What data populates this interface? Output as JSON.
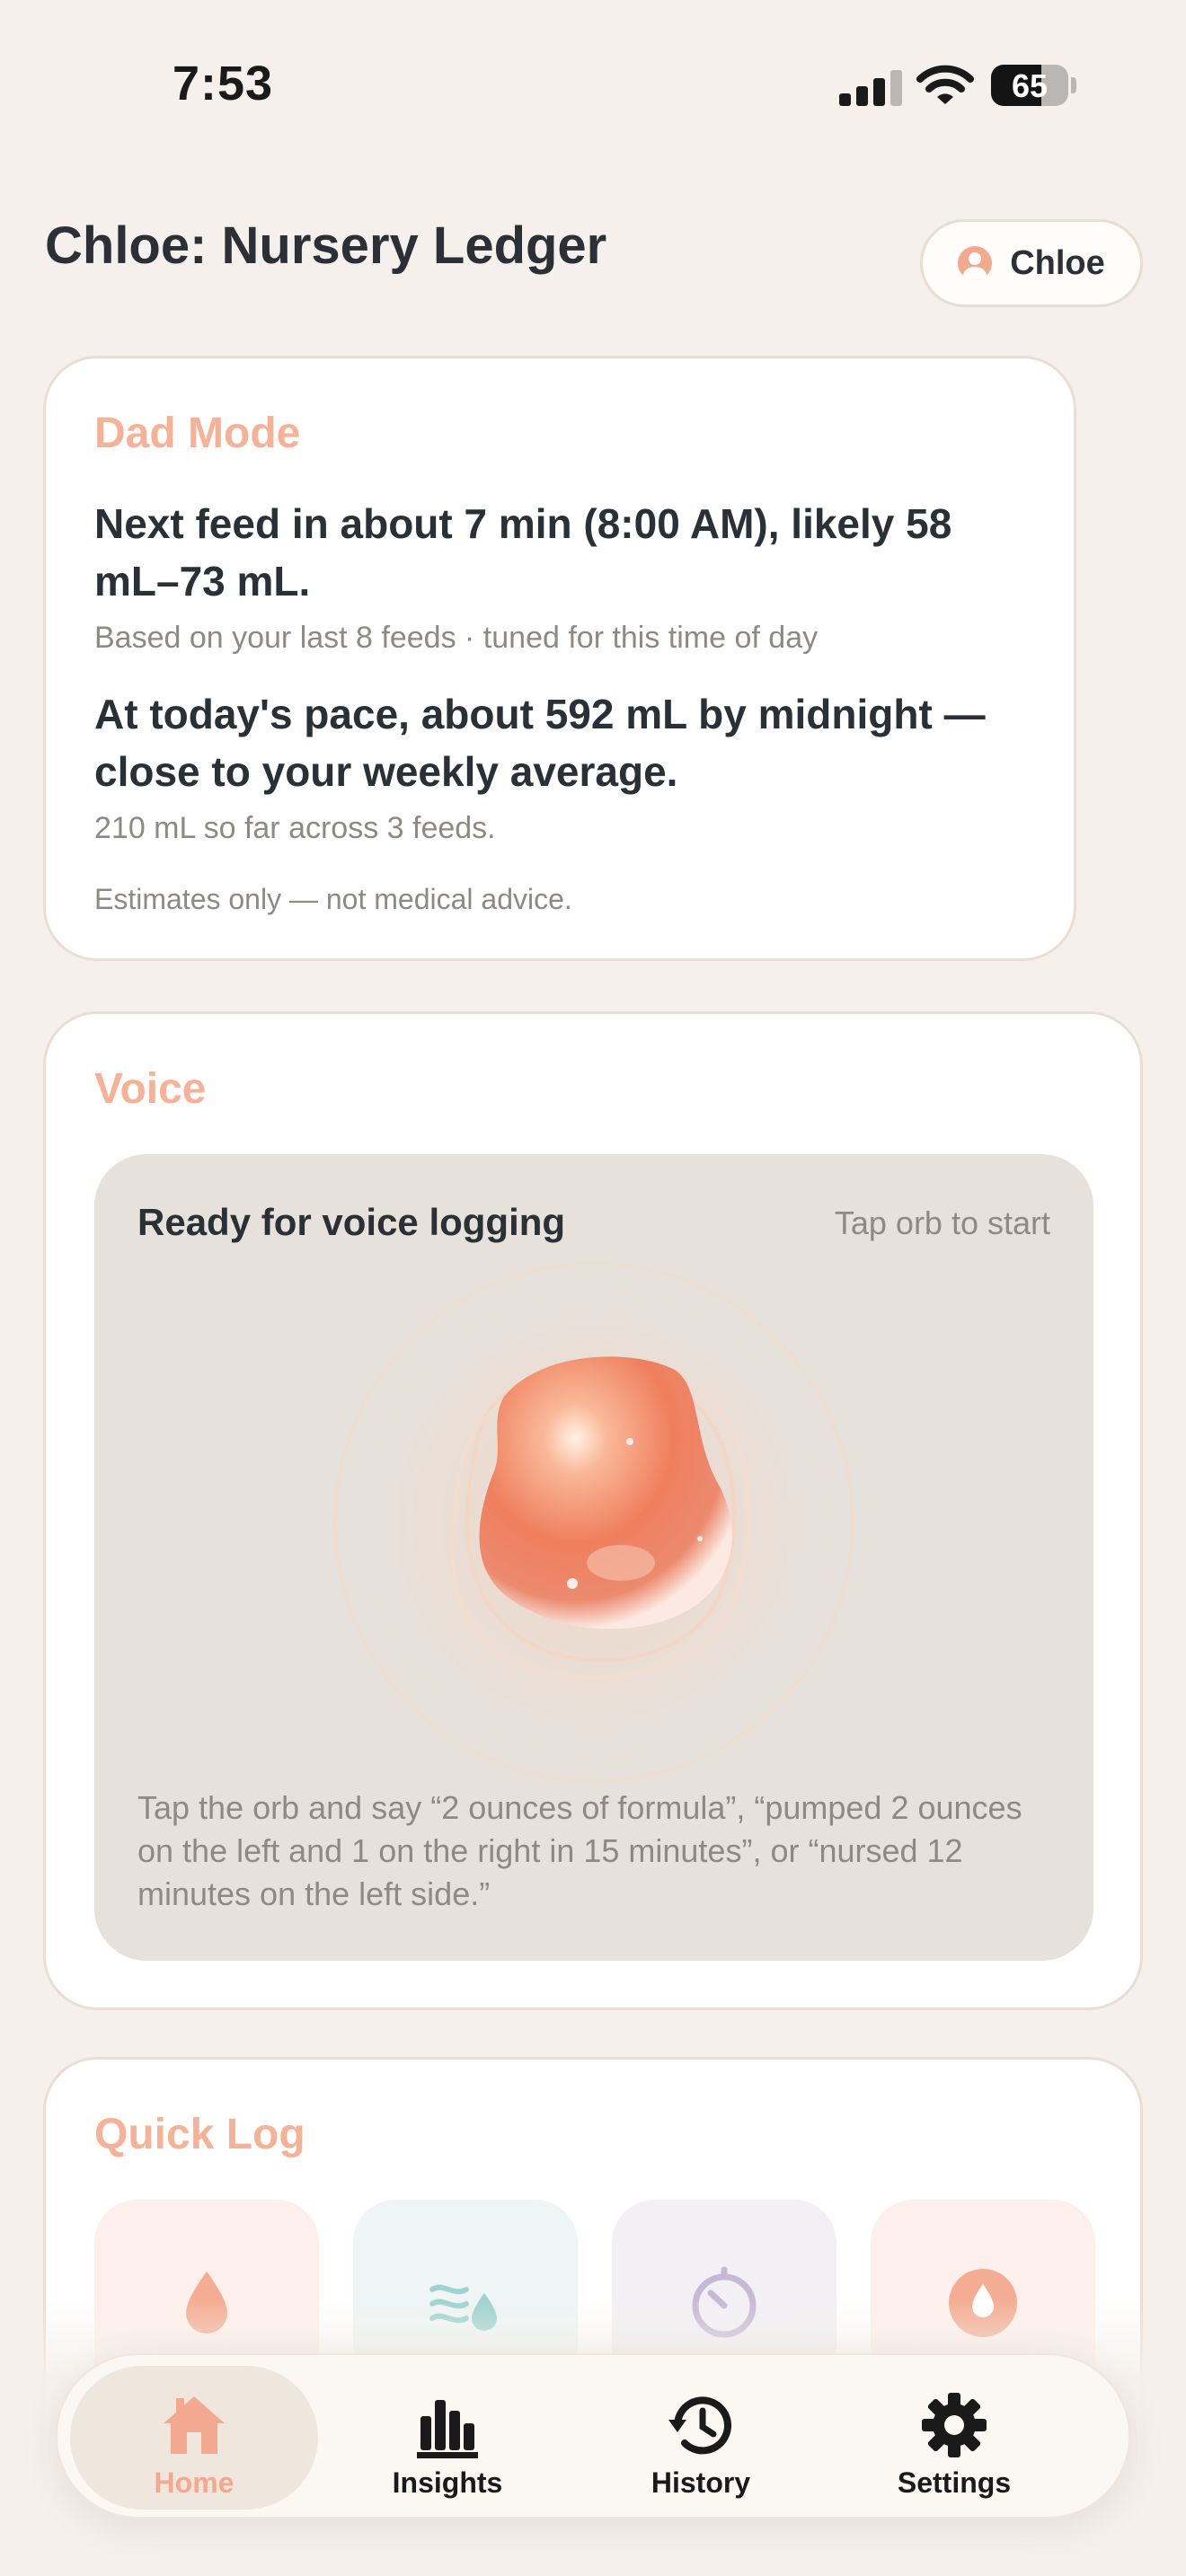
{
  "status_bar": {
    "time": "7:53",
    "battery_level": "65",
    "icons": [
      "cellular-signal-icon",
      "wifi-icon",
      "battery-icon"
    ]
  },
  "header": {
    "title": "Chloe: Nursery Ledger",
    "profile_button_label": "Chloe",
    "profile_icon": "person-circle-icon"
  },
  "dad_mode": {
    "title": "Dad Mode",
    "next_feed": "Next feed in about 7 min (8:00 AM), likely 58 mL–73 mL.",
    "next_feed_basis": "Based on your last 8 feeds · tuned for this time of day",
    "pace": "At today's pace, about 592 mL by midnight — close to your weekly average.",
    "pace_detail": "210 mL so far across 3 feeds.",
    "disclaimer": "Estimates only — not medical advice."
  },
  "voice": {
    "title": "Voice",
    "status": "Ready for voice logging",
    "hint": "Tap orb to start",
    "instructions": "Tap the orb and say “2 ounces of formula”, “pumped 2 ounces on the left and 1 on the right in 15 minutes”, or “nursed 12 minutes on the left side.”"
  },
  "quick_log": {
    "title": "Quick Log",
    "tiles": [
      {
        "icon": "drop-icon",
        "bg": "#fdf0ec",
        "color": "#f4ad93"
      },
      {
        "icon": "wind-drop-icon",
        "bg": "#eef5f4",
        "color": "#9fd3d0"
      },
      {
        "icon": "timer-icon",
        "bg": "#f2f0f4",
        "color": "#c6b9d6"
      },
      {
        "icon": "drop-circle-icon",
        "bg": "#fdf0ec",
        "color": "#f4ad93"
      }
    ]
  },
  "tab_bar": {
    "tabs": [
      {
        "label": "Home",
        "icon": "house-icon",
        "active": true
      },
      {
        "label": "Insights",
        "icon": "bar-chart-icon",
        "active": false
      },
      {
        "label": "History",
        "icon": "history-clock-icon",
        "active": false
      },
      {
        "label": "Settings",
        "icon": "gear-icon",
        "active": false
      }
    ]
  },
  "colors": {
    "background": "#f5f0eb",
    "accent": "#f5b297",
    "text_primary": "#2b3036",
    "text_secondary": "#8d8a86",
    "orb": "#ee7a5a"
  }
}
